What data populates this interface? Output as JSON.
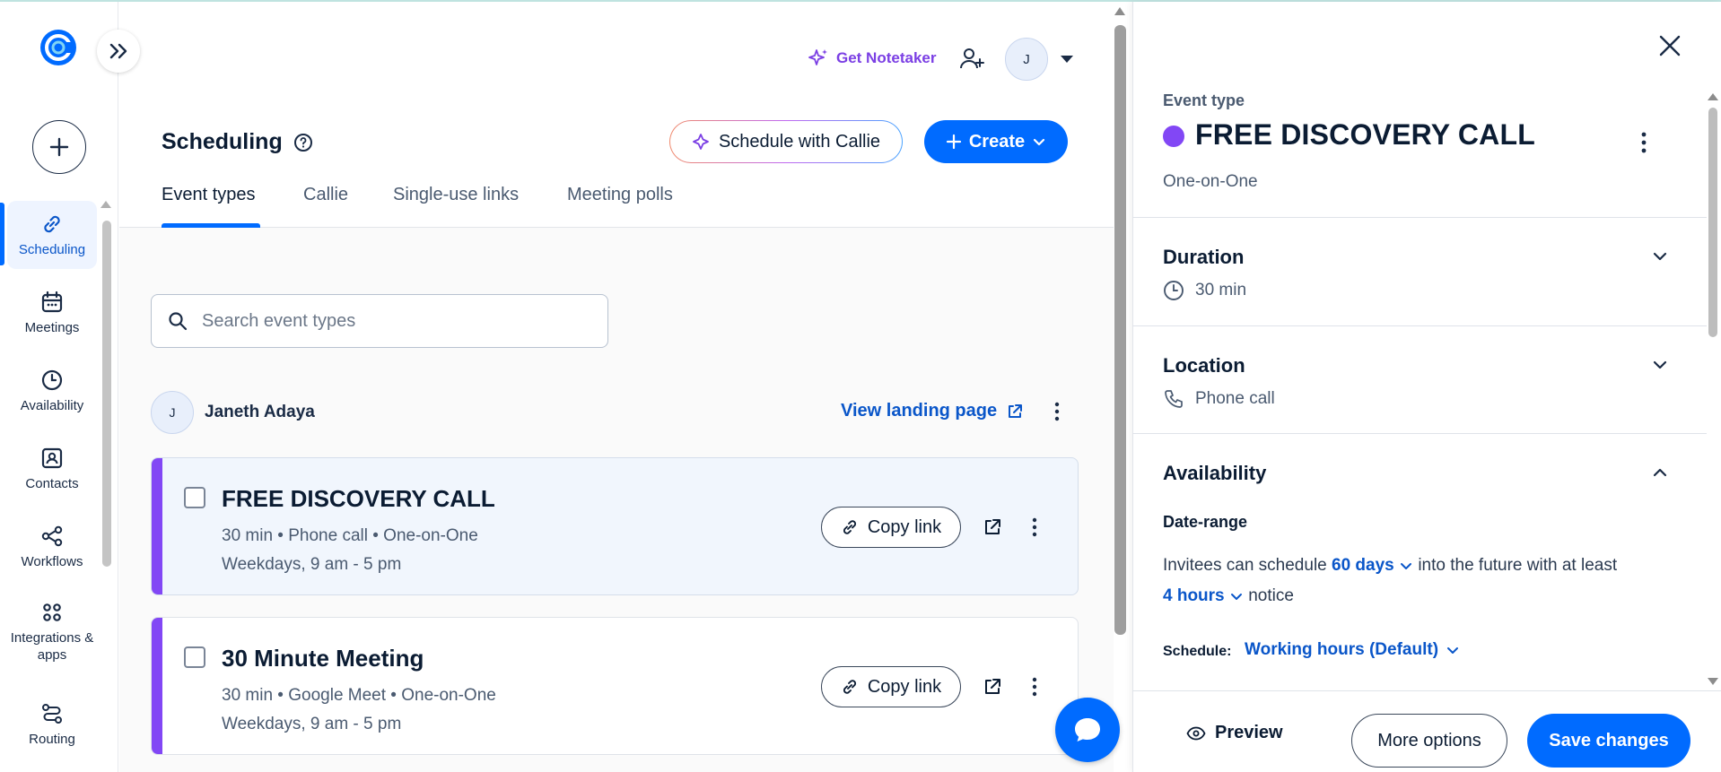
{
  "header": {
    "notetaker_label": "Get Notetaker",
    "avatar_initial": "J"
  },
  "sidebar": {
    "items": [
      {
        "label": "Scheduling",
        "icon": "link-icon"
      },
      {
        "label": "Meetings",
        "icon": "calendar-icon"
      },
      {
        "label": "Availability",
        "icon": "clock-icon"
      },
      {
        "label": "Contacts",
        "icon": "contact-book-icon"
      },
      {
        "label": "Workflows",
        "icon": "workflow-icon"
      },
      {
        "label": "Integrations & apps",
        "icon": "grid-icon"
      },
      {
        "label": "Routing",
        "icon": "routing-icon"
      }
    ]
  },
  "page": {
    "title": "Scheduling",
    "callie_button": "Schedule with Callie",
    "create_button": "Create",
    "tabs": [
      "Event types",
      "Callie",
      "Single-use links",
      "Meeting polls"
    ]
  },
  "search": {
    "placeholder": "Search event types"
  },
  "owner": {
    "initial": "J",
    "name": "Janeth Adaya",
    "landing_link": "View landing page"
  },
  "events": [
    {
      "title": "FREE DISCOVERY CALL",
      "meta": "30 min • Phone call • One-on-One",
      "schedule": "Weekdays, 9 am - 5 pm",
      "copy_label": "Copy link",
      "color": "#8247f5"
    },
    {
      "title": "30 Minute Meeting",
      "meta": "30 min • Google Meet • One-on-One",
      "schedule": "Weekdays, 9 am - 5 pm",
      "copy_label": "Copy link",
      "color": "#8247f5"
    }
  ],
  "panel": {
    "label": "Event type",
    "title": "FREE DISCOVERY CALL",
    "type": "One-on-One",
    "color": "#8247f5",
    "duration": {
      "heading": "Duration",
      "value": "30 min"
    },
    "location": {
      "heading": "Location",
      "value": "Phone call"
    },
    "availability": {
      "heading": "Availability",
      "date_range_label": "Date-range",
      "text_1": "Invitees can schedule",
      "days": "60 days",
      "text_2": "into the future with at least",
      "hours": "4 hours",
      "text_3": "notice",
      "schedule_label": "Schedule:",
      "schedule_value": "Working hours (Default)"
    },
    "footer": {
      "preview": "Preview",
      "more_options": "More options",
      "save": "Save changes"
    }
  },
  "colors": {
    "accent": "#006bff",
    "event_purple": "#8247f5",
    "notetaker_purple": "#7b3fe4"
  }
}
